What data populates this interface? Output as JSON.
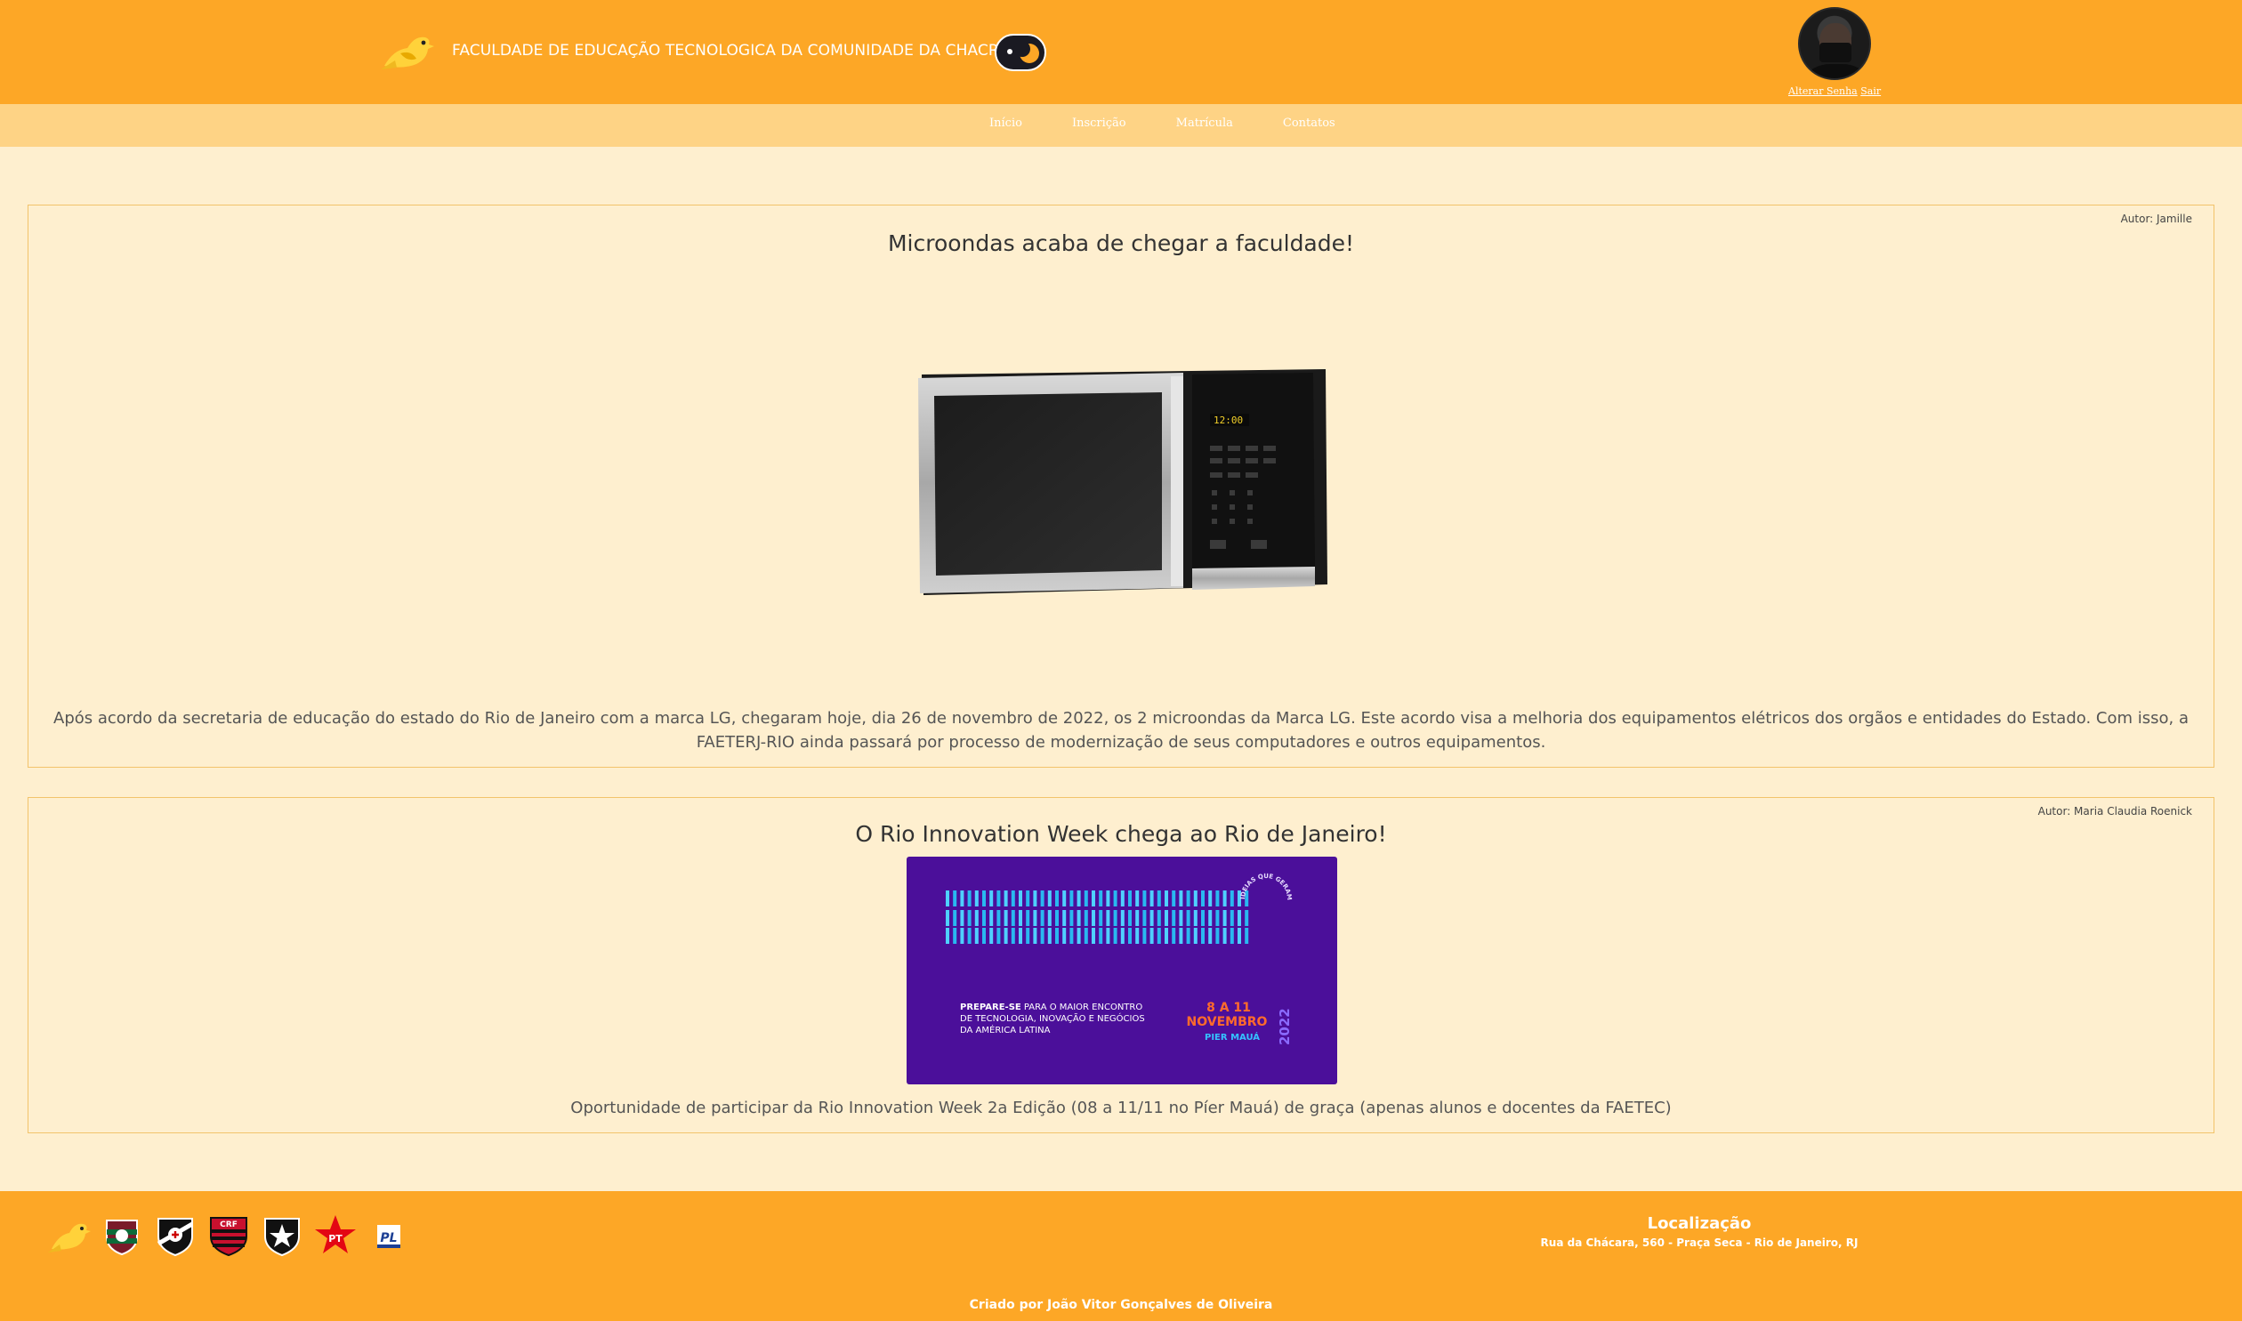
{
  "header": {
    "title": "FACULDADE DE EDUCAÇÃO TECNOLOGICA DA COMUNIDADE DA CHACRINHA",
    "change_password_link": "Alterar Senha",
    "logout_link": "Sair"
  },
  "nav": {
    "items": [
      {
        "label": "Início"
      },
      {
        "label": "Inscrição"
      },
      {
        "label": "Matrícula"
      },
      {
        "label": "Contatos"
      }
    ]
  },
  "posts": [
    {
      "author": "Autor: Jamille",
      "title": "Microondas acaba de chegar a faculdade!",
      "image_clock": "12:00",
      "text": "Após acordo da secretaria de educação do estado do Rio de Janeiro com a marca LG, chegaram hoje, dia 26 de novembro de 2022, os 2 microondas da Marca LG. Este acordo visa a melhoria dos equipamentos elétricos dos orgãos e entidades do Estado. Com isso, a FAETERJ-RIO ainda passará por processo de modernização de seus computadores e outros equipamentos."
    },
    {
      "author": "Autor: Maria Claudia Roenick",
      "title": "O Rio Innovation Week chega ao Rio de Janeiro!",
      "poster": {
        "ring_text": "IDEIAS QUE GERAM NEGÓCIOS",
        "tagline_bold": "PREPARE-SE",
        "tagline_rest": " PARA O MAIOR ENCONTRO",
        "tagline_line2": "DE TECNOLOGIA, INOVAÇÃO E NEGÓCIOS",
        "tagline_line3": "DA AMÉRICA LATINA",
        "date_days": "8 A 11",
        "date_month": "NOVEMBRO",
        "year": "2022",
        "venue": "PIER MAUÁ"
      },
      "text": "Oportunidade de participar da Rio Innovation Week 2a Edição (08 a 11/11 no Píer Mauá) de graça (apenas alunos e docentes da FAETEC)"
    }
  ],
  "footer": {
    "logos": [
      "bird-logo",
      "fluminense-logo",
      "vasco-logo",
      "flamengo-logo",
      "botafogo-logo",
      "pt-logo",
      "pl-logo"
    ],
    "pt_label": "PT",
    "pl_label": "PL",
    "location_title": "Localização",
    "location_address": "Rua da Chácara, 560 - Praça Seca - Rio de Janeiro, RJ",
    "credits": "Criado por João Vitor Gonçalves de Oliveira"
  },
  "colors": {
    "header_bg": "#fda726",
    "nav_bg": "#fed385",
    "page_bg": "#feefcf",
    "card_border": "#f2c36b",
    "poster_bg": "#4b0f9a"
  }
}
